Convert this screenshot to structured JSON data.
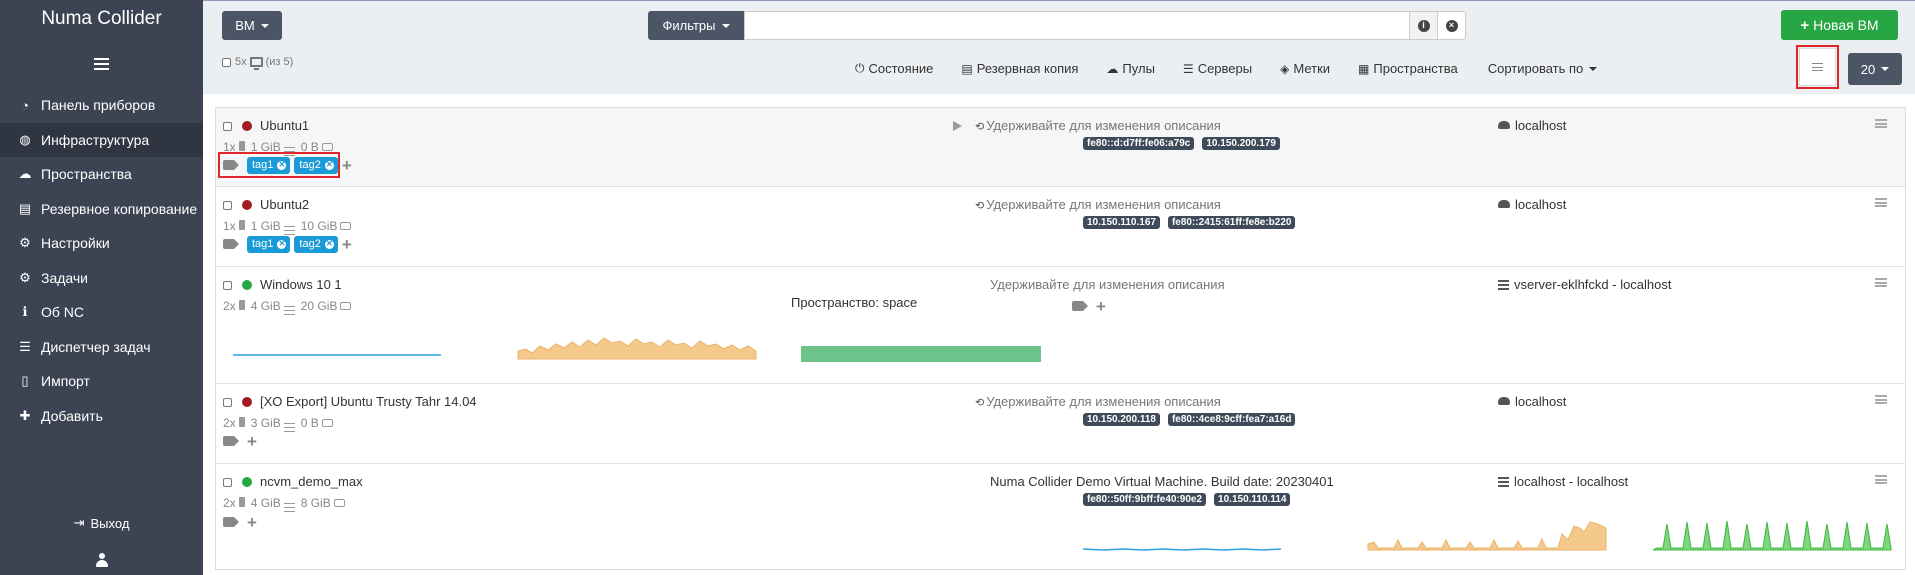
{
  "app": {
    "title": "Numa Collider"
  },
  "sidebar": {
    "items": [
      {
        "label": "Панель приборов",
        "icon": "dashboard-icon",
        "glyph": "◔"
      },
      {
        "label": "Инфраструктура",
        "icon": "globe-icon",
        "glyph": "◍",
        "active": true
      },
      {
        "label": "Пространства",
        "icon": "cloud-icon",
        "glyph": "☁"
      },
      {
        "label": "Резервное копирование",
        "icon": "archive-icon",
        "glyph": "▤"
      },
      {
        "label": "Настройки",
        "icon": "gear-icon",
        "glyph": "⚙"
      },
      {
        "label": "Задачи",
        "icon": "cogs-icon",
        "glyph": "⚙"
      },
      {
        "label": "Об NC",
        "icon": "info-icon",
        "glyph": "ℹ"
      },
      {
        "label": "Диспетчер задач",
        "icon": "tasks-icon",
        "glyph": "☰"
      },
      {
        "label": "Импорт",
        "icon": "file-import-icon",
        "glyph": "▯"
      },
      {
        "label": "Добавить",
        "icon": "plus-icon",
        "glyph": "✚"
      }
    ],
    "logout": {
      "label": "Выход",
      "icon": "sign-out-icon",
      "glyph": "⇥"
    }
  },
  "toolbar": {
    "type_label": "ВМ",
    "filter_label": "Фильтры",
    "filter_value": "",
    "new_vm_plus": "+",
    "new_vm_label": "Новая ВМ",
    "selection_count": "5x",
    "selection_total": "(из 5)",
    "sort_items": [
      {
        "label": "Состояние",
        "icon": "power-icon",
        "glyph": "⏻"
      },
      {
        "label": "Резервная копия",
        "icon": "archive-icon",
        "glyph": "▤"
      },
      {
        "label": "Пулы",
        "icon": "cloud-icon",
        "glyph": "☁"
      },
      {
        "label": "Серверы",
        "icon": "server-icon",
        "glyph": "☰"
      },
      {
        "label": "Метки",
        "icon": "tags-icon",
        "glyph": "◈"
      },
      {
        "label": "Пространства",
        "icon": "list-alt-icon",
        "glyph": "▦"
      }
    ],
    "sort_by_label": "Сортировать по",
    "per_page": "20"
  },
  "vms": [
    {
      "name": "Ubuntu1",
      "status_color": "#a31b20",
      "cpus": "1x",
      "memory": "1 GiB",
      "disk": "0 B",
      "tags": [
        "tag1",
        "tag2"
      ],
      "description": "Удерживайте для изменения описания",
      "ips": [
        "fe80::d:d7ff:fe06:a79c",
        "10.150.200.179"
      ],
      "host": "localhost"
    },
    {
      "name": "Ubuntu2",
      "status_color": "#a31b20",
      "cpus": "1x",
      "memory": "1 GiB",
      "disk": "10 GiB",
      "tags": [
        "tag1",
        "tag2"
      ],
      "description": "Удерживайте для изменения описания",
      "ips": [
        "10.150.110.167",
        "fe80::2415:61ff:fe8e:b220"
      ],
      "host": "localhost"
    },
    {
      "name": "Windows 10 1",
      "status_color": "#27a744",
      "cpus": "2x",
      "memory": "4 GiB",
      "disk": "20 GiB",
      "tags": [],
      "space_label": "Пространство:",
      "space_value": "space",
      "description": "Удерживайте для изменения описания",
      "ips": [],
      "host": "vserver-eklhfckd - localhost"
    },
    {
      "name": "[XO Export] Ubuntu Trusty Tahr 14.04",
      "status_color": "#a31b20",
      "cpus": "2x",
      "memory": "3 GiB",
      "disk": "0 B",
      "tags": [],
      "description": "Удерживайте для изменения описания",
      "ips": [
        "10.150.200.118",
        "fe80::4ce8:9cff:fea7:a16d"
      ],
      "host": "localhost"
    },
    {
      "name": "ncvm_demo_max",
      "status_color": "#27a744",
      "cpus": "2x",
      "memory": "4 GiB",
      "disk": "8 GiB",
      "tags": [],
      "description": "Numa Collider Demo Virtual Machine. Build date: 20230401",
      "ips": [
        "fe80::50ff:9bff:fe40:90e2",
        "10.150.110.114"
      ],
      "host": "localhost - localhost"
    }
  ],
  "colors": {
    "sidebar": "#3c4453",
    "accent": "#1a9ad6",
    "success": "#27a744",
    "danger": "#a31b20",
    "highlight": "#e0262b"
  }
}
